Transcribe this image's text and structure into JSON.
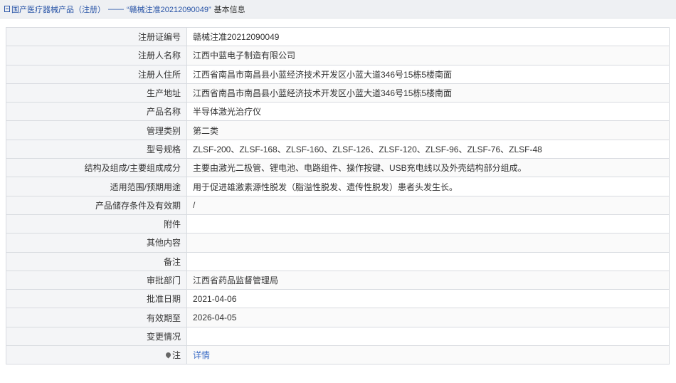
{
  "breadcrumb": {
    "root": "国产医疗器械产品（注册）",
    "separator": "——",
    "current": "“赣械注准20212090049”",
    "suffix": "基本信息"
  },
  "rows": [
    {
      "label": "注册证编号",
      "value": "赣械注准20212090049"
    },
    {
      "label": "注册人名称",
      "value": "江西中蓝电子制造有限公司"
    },
    {
      "label": "注册人住所",
      "value": "江西省南昌市南昌县小蓝经济技术开发区小蓝大道346号15栋5楼南面"
    },
    {
      "label": "生产地址",
      "value": "江西省南昌市南昌县小蓝经济技术开发区小蓝大道346号15栋5楼南面"
    },
    {
      "label": "产品名称",
      "value": "半导体激光治疗仪"
    },
    {
      "label": "管理类别",
      "value": "第二类"
    },
    {
      "label": "型号规格",
      "value": "ZLSF-200、ZLSF-168、ZLSF-160、ZLSF-126、ZLSF-120、ZLSF-96、ZLSF-76、ZLSF-48"
    },
    {
      "label": "结构及组成/主要组成成分",
      "value": "主要由激光二极管、锂电池、电路组件、操作按键、USB充电线以及外壳结构部分组成。"
    },
    {
      "label": "适用范围/预期用途",
      "value": "用于促进雄激素源性脱发（脂溢性脱发、遗传性脱发）患者头发生长。"
    },
    {
      "label": "产品储存条件及有效期",
      "value": "/"
    },
    {
      "label": "附件",
      "value": ""
    },
    {
      "label": "其他内容",
      "value": ""
    },
    {
      "label": "备注",
      "value": ""
    },
    {
      "label": "审批部门",
      "value": "江西省药品监督管理局"
    },
    {
      "label": "批准日期",
      "value": "2021-04-06"
    },
    {
      "label": "有效期至",
      "value": "2026-04-05"
    },
    {
      "label": "变更情况",
      "value": ""
    },
    {
      "label": "注",
      "value": "详情"
    }
  ]
}
